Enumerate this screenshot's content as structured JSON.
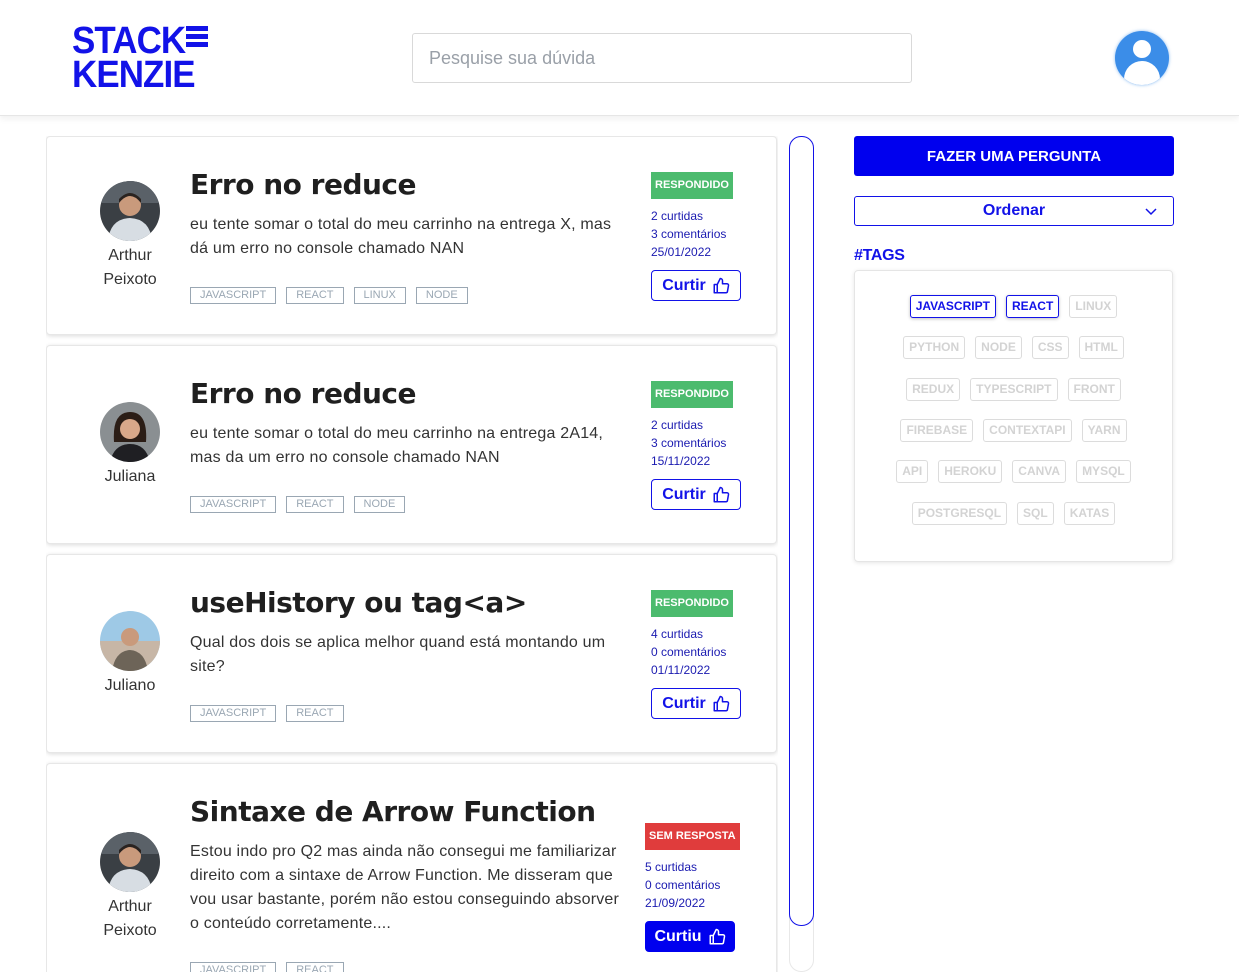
{
  "header": {
    "logo_line1": "STACK",
    "logo_line2": "KENZIE",
    "search_placeholder": "Pesquise sua dúvida"
  },
  "questions": [
    {
      "title": "Erro no reduce",
      "text": "eu tente somar o total do meu carrinho na entrega X, mas dá um erro no console chamado NAN",
      "author": "Arthur Peixoto",
      "tags": [
        "JAVASCRIPT",
        "REACT",
        "LINUX",
        "NODE"
      ],
      "status": "RESPONDIDO",
      "likes": "2 curtidas",
      "comments": "3 comentários",
      "date": "25/01/2022",
      "like_label": "Curtir"
    },
    {
      "title": "Erro no reduce",
      "text": "eu tente somar o total do meu carrinho na entrega 2A14, mas da um erro no console chamado NAN",
      "author": "Juliana",
      "tags": [
        "JAVASCRIPT",
        "REACT",
        "NODE"
      ],
      "status": "RESPONDIDO",
      "likes": "2 curtidas",
      "comments": "3 comentários",
      "date": "15/11/2022",
      "like_label": "Curtir"
    },
    {
      "title": "useHistory ou tag<a>",
      "text": "Qual dos dois se aplica melhor quand está montando um site?",
      "author": "Juliano",
      "tags": [
        "JAVASCRIPT",
        "REACT"
      ],
      "status": "RESPONDIDO",
      "likes": "4 curtidas",
      "comments": "0 comentários",
      "date": "01/11/2022",
      "like_label": "Curtir"
    },
    {
      "title": "Sintaxe de Arrow Function",
      "text": "Estou indo pro Q2 mas ainda não consegui me familiarizar direito com a sintaxe de Arrow Function. Me disseram que vou usar bastante, porém não estou conseguindo absorver o conteúdo corretamente....",
      "author": "Arthur Peixoto",
      "tags": [
        "JAVASCRIPT",
        "REACT"
      ],
      "status": "SEM RESPOSTA",
      "likes": "5 curtidas",
      "comments": "0 comentários",
      "date": "21/09/2022",
      "like_label": "Curtiu"
    }
  ],
  "sidebar": {
    "ask_label": "FAZER UMA PERGUNTA",
    "order_label": "Ordenar",
    "tags_title": "#TAGS",
    "tag_rows": [
      [
        "JAVASCRIPT",
        "REACT",
        "LINUX"
      ],
      [
        "PYTHON",
        "NODE",
        "CSS",
        "HTML"
      ],
      [
        "REDUX",
        "TYPESCRIPT",
        "FRONT"
      ],
      [
        "FIREBASE",
        "CONTEXTAPI",
        "YARN"
      ],
      [
        "API",
        "HEROKU",
        "CANVA",
        "MYSQL"
      ],
      [
        "POSTGRESQL",
        "SQL",
        "KATAS"
      ]
    ],
    "active_tags": [
      "JAVASCRIPT",
      "REACT"
    ]
  },
  "colors": {
    "brand_blue": "#1212e8",
    "answered_green": "#4cbb6e",
    "unanswered_red": "#e03c3c"
  },
  "icons": [
    "thumbs-up-icon",
    "chevron-down-icon",
    "user-icon"
  ]
}
